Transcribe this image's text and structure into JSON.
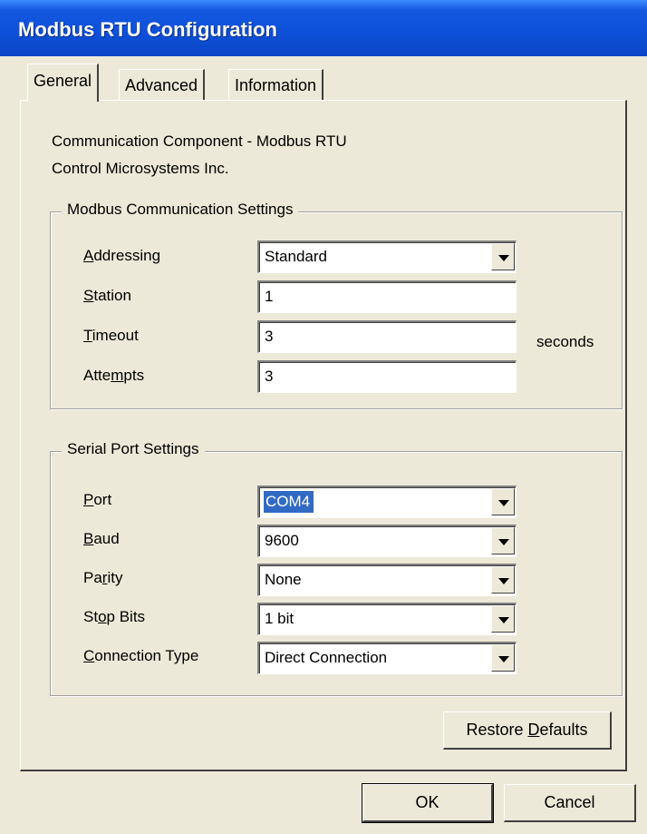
{
  "window": {
    "title": "Modbus RTU Configuration"
  },
  "tabs": [
    {
      "label": "General"
    },
    {
      "label": "Advanced"
    },
    {
      "label": "Information"
    }
  ],
  "general": {
    "component_name": "Communication Component - Modbus RTU",
    "vendor": "Control Microsystems Inc.",
    "modbus_group": {
      "title": "Modbus Communication Settings",
      "addressing": {
        "label": "Addressing",
        "value": "Standard"
      },
      "station": {
        "label": "Station",
        "value": "1"
      },
      "timeout": {
        "label": "Timeout",
        "value": "3",
        "unit": "seconds"
      },
      "attempts": {
        "label": "Attempts",
        "value": "3"
      }
    },
    "serial_group": {
      "title": "Serial Port Settings",
      "port": {
        "label": "Port",
        "value": "COM4"
      },
      "baud": {
        "label": "Baud",
        "value": "9600"
      },
      "parity": {
        "label": "Parity",
        "value": "None"
      },
      "stop_bits": {
        "label": "Stop Bits",
        "value": "1 bit"
      },
      "connection_type": {
        "label": "Connection Type",
        "value": "Direct Connection"
      }
    },
    "restore_defaults_label": "Restore Defaults"
  },
  "buttons": {
    "ok": "OK",
    "cancel": "Cancel"
  }
}
